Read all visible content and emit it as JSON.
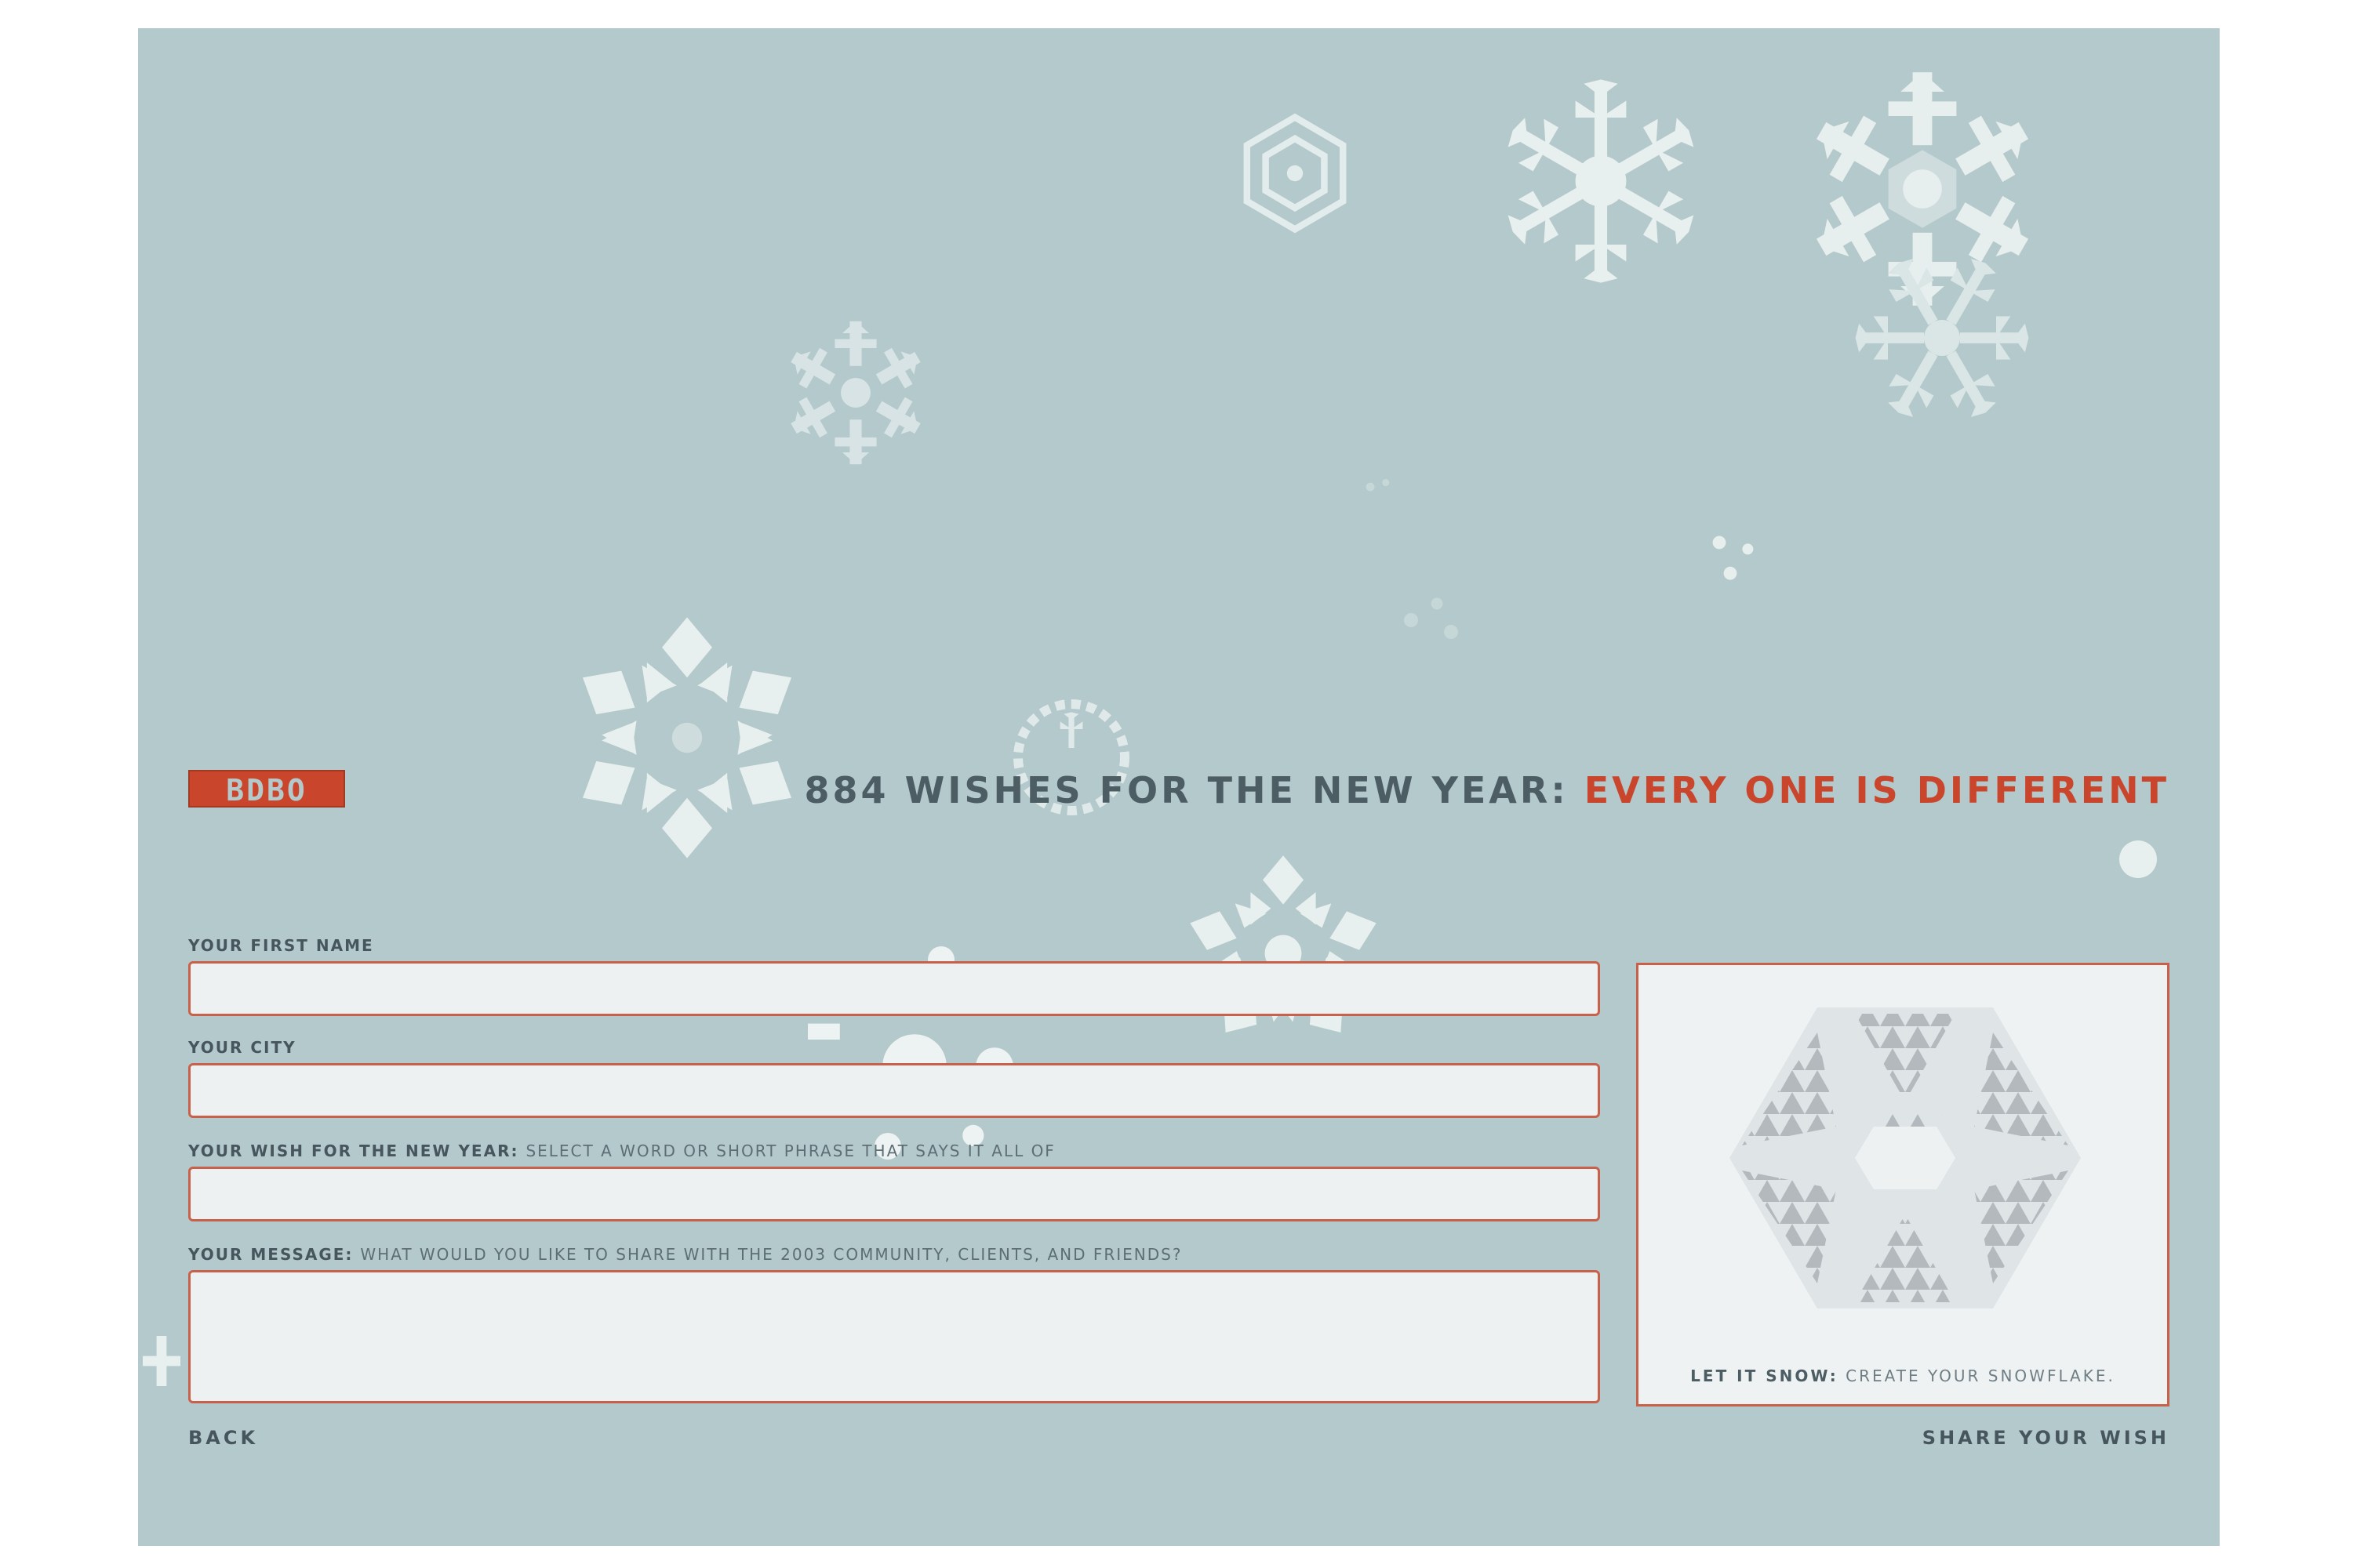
{
  "brand": {
    "logo_text": "BDBO",
    "accent_color": "#c9462c",
    "background_color": "#b4c9cb"
  },
  "headline": {
    "lead": "884 WISHES FOR THE NEW YEAR:",
    "accent": "EVERY ONE IS DIFFERENT"
  },
  "form": {
    "first_name": {
      "label": "YOUR FIRST NAME",
      "hint": "",
      "value": ""
    },
    "city": {
      "label": "YOUR CITY",
      "hint": "",
      "value": ""
    },
    "wish": {
      "label": "YOUR WISH FOR THE NEW YEAR:",
      "hint": "SELECT A WORD OR SHORT PHRASE THAT SAYS IT ALL OF",
      "value": ""
    },
    "message": {
      "label": "YOUR MESSAGE:",
      "hint": "WHAT WOULD YOU LIKE TO SHARE WITH THE 2003 COMMUNITY, CLIENTS, AND FRIENDS?",
      "value": ""
    }
  },
  "preview": {
    "caption_bold": "LET IT SNOW:",
    "caption_rest": "CREATE YOUR SNOWFLAKE.",
    "icon": "snowflake-preview"
  },
  "nav": {
    "back_label": "BACK",
    "share_label": "SHARE YOUR WISH"
  },
  "decor_icons": [
    "snowflake-icon"
  ]
}
